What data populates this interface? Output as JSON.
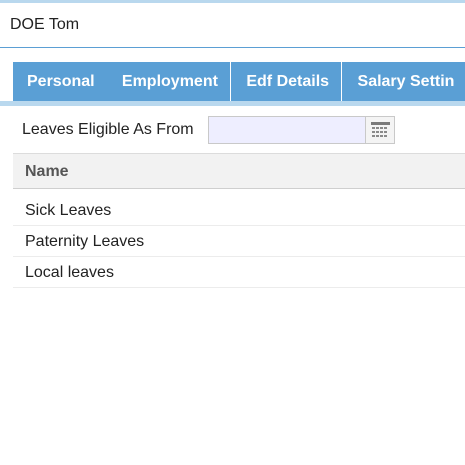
{
  "employee": {
    "name": "DOE Tom"
  },
  "tabs": [
    {
      "label": "Personal"
    },
    {
      "label": "Employment"
    },
    {
      "label": "Edf Details"
    },
    {
      "label": "Salary Settin"
    }
  ],
  "form": {
    "leaves_eligible_label": "Leaves Eligible As From",
    "leaves_eligible_value": "",
    "calendar_icon": "calendar-icon"
  },
  "table": {
    "columns": [
      "Name"
    ],
    "rows": [
      [
        "Sick Leaves"
      ],
      [
        "Paternity Leaves"
      ],
      [
        "Local leaves"
      ]
    ]
  },
  "colors": {
    "accent": "#5a9fd5",
    "accent_light": "#b9d8ee",
    "input_bg": "#eeeeff"
  }
}
